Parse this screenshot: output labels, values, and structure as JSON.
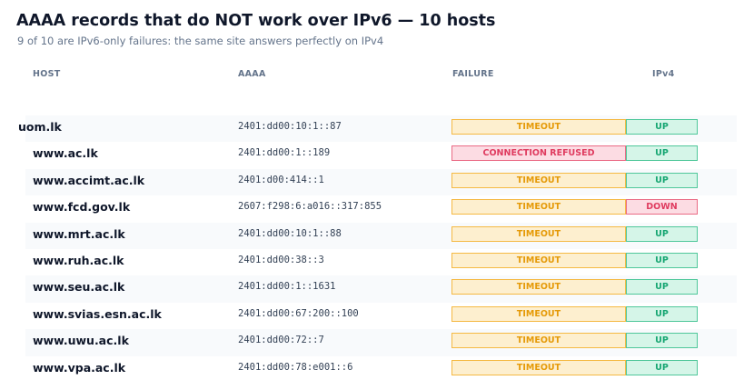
{
  "header": {
    "title": "AAAA records that do NOT work over IPv6 — 10 hosts",
    "subtitle": "9 of 10 are IPv6-only failures: the same site answers perfectly on IPv4"
  },
  "columns": {
    "host": "HOST",
    "aaaa": "AAAA",
    "failure": "FAILURE",
    "ipv4": "IPv4"
  },
  "colors": {
    "timeout_fill": "#fdefcf",
    "timeout_text": "#e59a08",
    "refused_fill": "#fcdce3",
    "refused_text": "#df3b5f",
    "up_fill": "#d5f5e8",
    "up_text": "#16a672"
  },
  "rows": [
    {
      "host": "uom.lk",
      "aaaa": "2401:dd00:10:1::87",
      "failure": "TIMEOUT",
      "ipv4": "UP"
    },
    {
      "host": "www.ac.lk",
      "aaaa": "2401:dd00:1::189",
      "failure": "CONNECTION REFUSED",
      "ipv4": "UP"
    },
    {
      "host": "www.accimt.ac.lk",
      "aaaa": "2401:d00:414::1",
      "failure": "TIMEOUT",
      "ipv4": "UP"
    },
    {
      "host": "www.fcd.gov.lk",
      "aaaa": "2607:f298:6:a016::317:855",
      "failure": "TIMEOUT",
      "ipv4": "DOWN"
    },
    {
      "host": "www.mrt.ac.lk",
      "aaaa": "2401:dd00:10:1::88",
      "failure": "TIMEOUT",
      "ipv4": "UP"
    },
    {
      "host": "www.ruh.ac.lk",
      "aaaa": "2401:dd00:38::3",
      "failure": "TIMEOUT",
      "ipv4": "UP"
    },
    {
      "host": "www.seu.ac.lk",
      "aaaa": "2401:dd00:1::1631",
      "failure": "TIMEOUT",
      "ipv4": "UP"
    },
    {
      "host": "www.svias.esn.ac.lk",
      "aaaa": "2401:dd00:67:200::100",
      "failure": "TIMEOUT",
      "ipv4": "UP"
    },
    {
      "host": "www.uwu.ac.lk",
      "aaaa": "2401:dd00:72::7",
      "failure": "TIMEOUT",
      "ipv4": "UP"
    },
    {
      "host": "www.vpa.ac.lk",
      "aaaa": "2401:dd00:78:e001::6",
      "failure": "TIMEOUT",
      "ipv4": "UP"
    }
  ]
}
